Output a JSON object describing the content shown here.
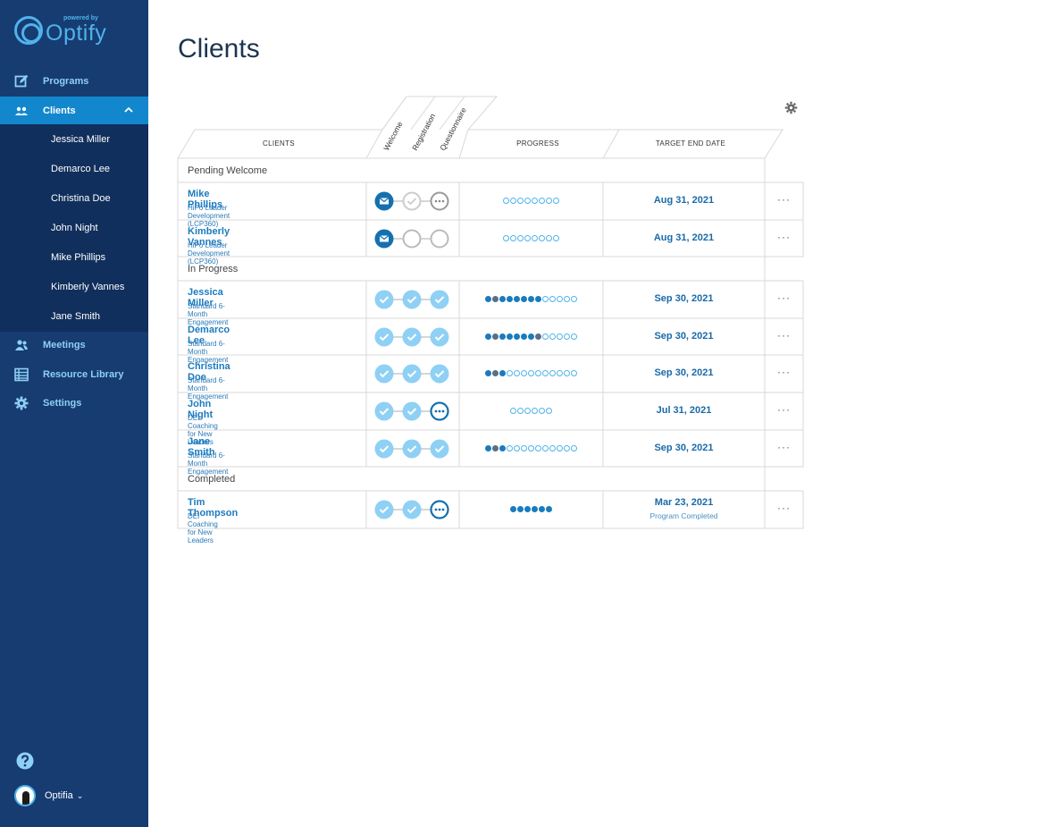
{
  "sidebar": {
    "logo_powered": "powered by",
    "logo_brand": "Optify",
    "nav": [
      {
        "label": "Programs",
        "icon": "edit-icon"
      },
      {
        "label": "Clients",
        "icon": "users-icon"
      },
      {
        "label": "Meetings",
        "icon": "meetings-icon"
      },
      {
        "label": "Resource Library",
        "icon": "library-icon"
      },
      {
        "label": "Settings",
        "icon": "gear-icon"
      }
    ],
    "clients_sub": [
      "Jessica Miller",
      "Demarco Lee",
      "Christina Doe",
      "John Night",
      "Mike Phillips",
      "Kimberly Vannes",
      "Jane Smith"
    ],
    "user_name": "Optifia"
  },
  "page": {
    "title": "Clients"
  },
  "table": {
    "headers": {
      "clients": "CLIENTS",
      "welcome": "Welcome",
      "registration": "Registration",
      "questionnaire": "Questionnaire",
      "progress": "PROGRESS",
      "target": "TARGET END DATE"
    },
    "sections": [
      {
        "label": "Pending Welcome",
        "rows": [
          {
            "name": "Mike Phillips",
            "program": "HiPo Leader Development (LCP360)",
            "status": [
              "mail",
              "pending-check",
              "pending-dots"
            ],
            "progress": "00000000",
            "date": "Aug 31, 2021",
            "date_sub": ""
          },
          {
            "name": "Kimberly Vannes",
            "program": "HiPo Leader Development (LCP360)",
            "status": [
              "mail",
              "empty",
              "empty"
            ],
            "progress": "00000000",
            "date": "Aug 31, 2021",
            "date_sub": ""
          }
        ]
      },
      {
        "label": "In Progress",
        "rows": [
          {
            "name": "Jessica Miller",
            "program": "Standard 6-Month Engagement",
            "status": [
              "done",
              "done",
              "done"
            ],
            "progress": "fgffffff00000",
            "date": "Sep 30, 2021",
            "date_sub": ""
          },
          {
            "name": "Demarco Lee",
            "program": "Standard 6-Month Engagement",
            "status": [
              "done",
              "done",
              "done"
            ],
            "progress": "fgfffffg00000",
            "date": "Sep 30, 2021",
            "date_sub": ""
          },
          {
            "name": "Christina Doe",
            "program": "Standard 6-Month Engagement",
            "status": [
              "done",
              "done",
              "done"
            ],
            "progress": "fgf0000000000",
            "date": "Sep 30, 2021",
            "date_sub": ""
          },
          {
            "name": "John Night",
            "program": "DEI Coaching for New Leaders",
            "status": [
              "done",
              "done",
              "active-dots"
            ],
            "progress": "000000",
            "date": "Jul 31, 2021",
            "date_sub": ""
          },
          {
            "name": "Jane Smith",
            "program": "Standard 6-Month Engagement",
            "status": [
              "done",
              "done",
              "done"
            ],
            "progress": "fgf0000000000",
            "date": "Sep 30, 2021",
            "date_sub": ""
          }
        ]
      },
      {
        "label": "Completed",
        "rows": [
          {
            "name": "Tim Thompson",
            "program": "DEI Coaching for New Leaders",
            "status": [
              "done",
              "done",
              "active-dots"
            ],
            "progress": "ffffff",
            "date": "Mar 23, 2021",
            "date_sub": "Program Completed"
          }
        ]
      }
    ],
    "more_label": "···"
  },
  "colors": {
    "sidebar_bg": "#163c72",
    "active_nav": "#1387cd",
    "accent": "#4fb3ea",
    "link": "#1a7bbf"
  }
}
